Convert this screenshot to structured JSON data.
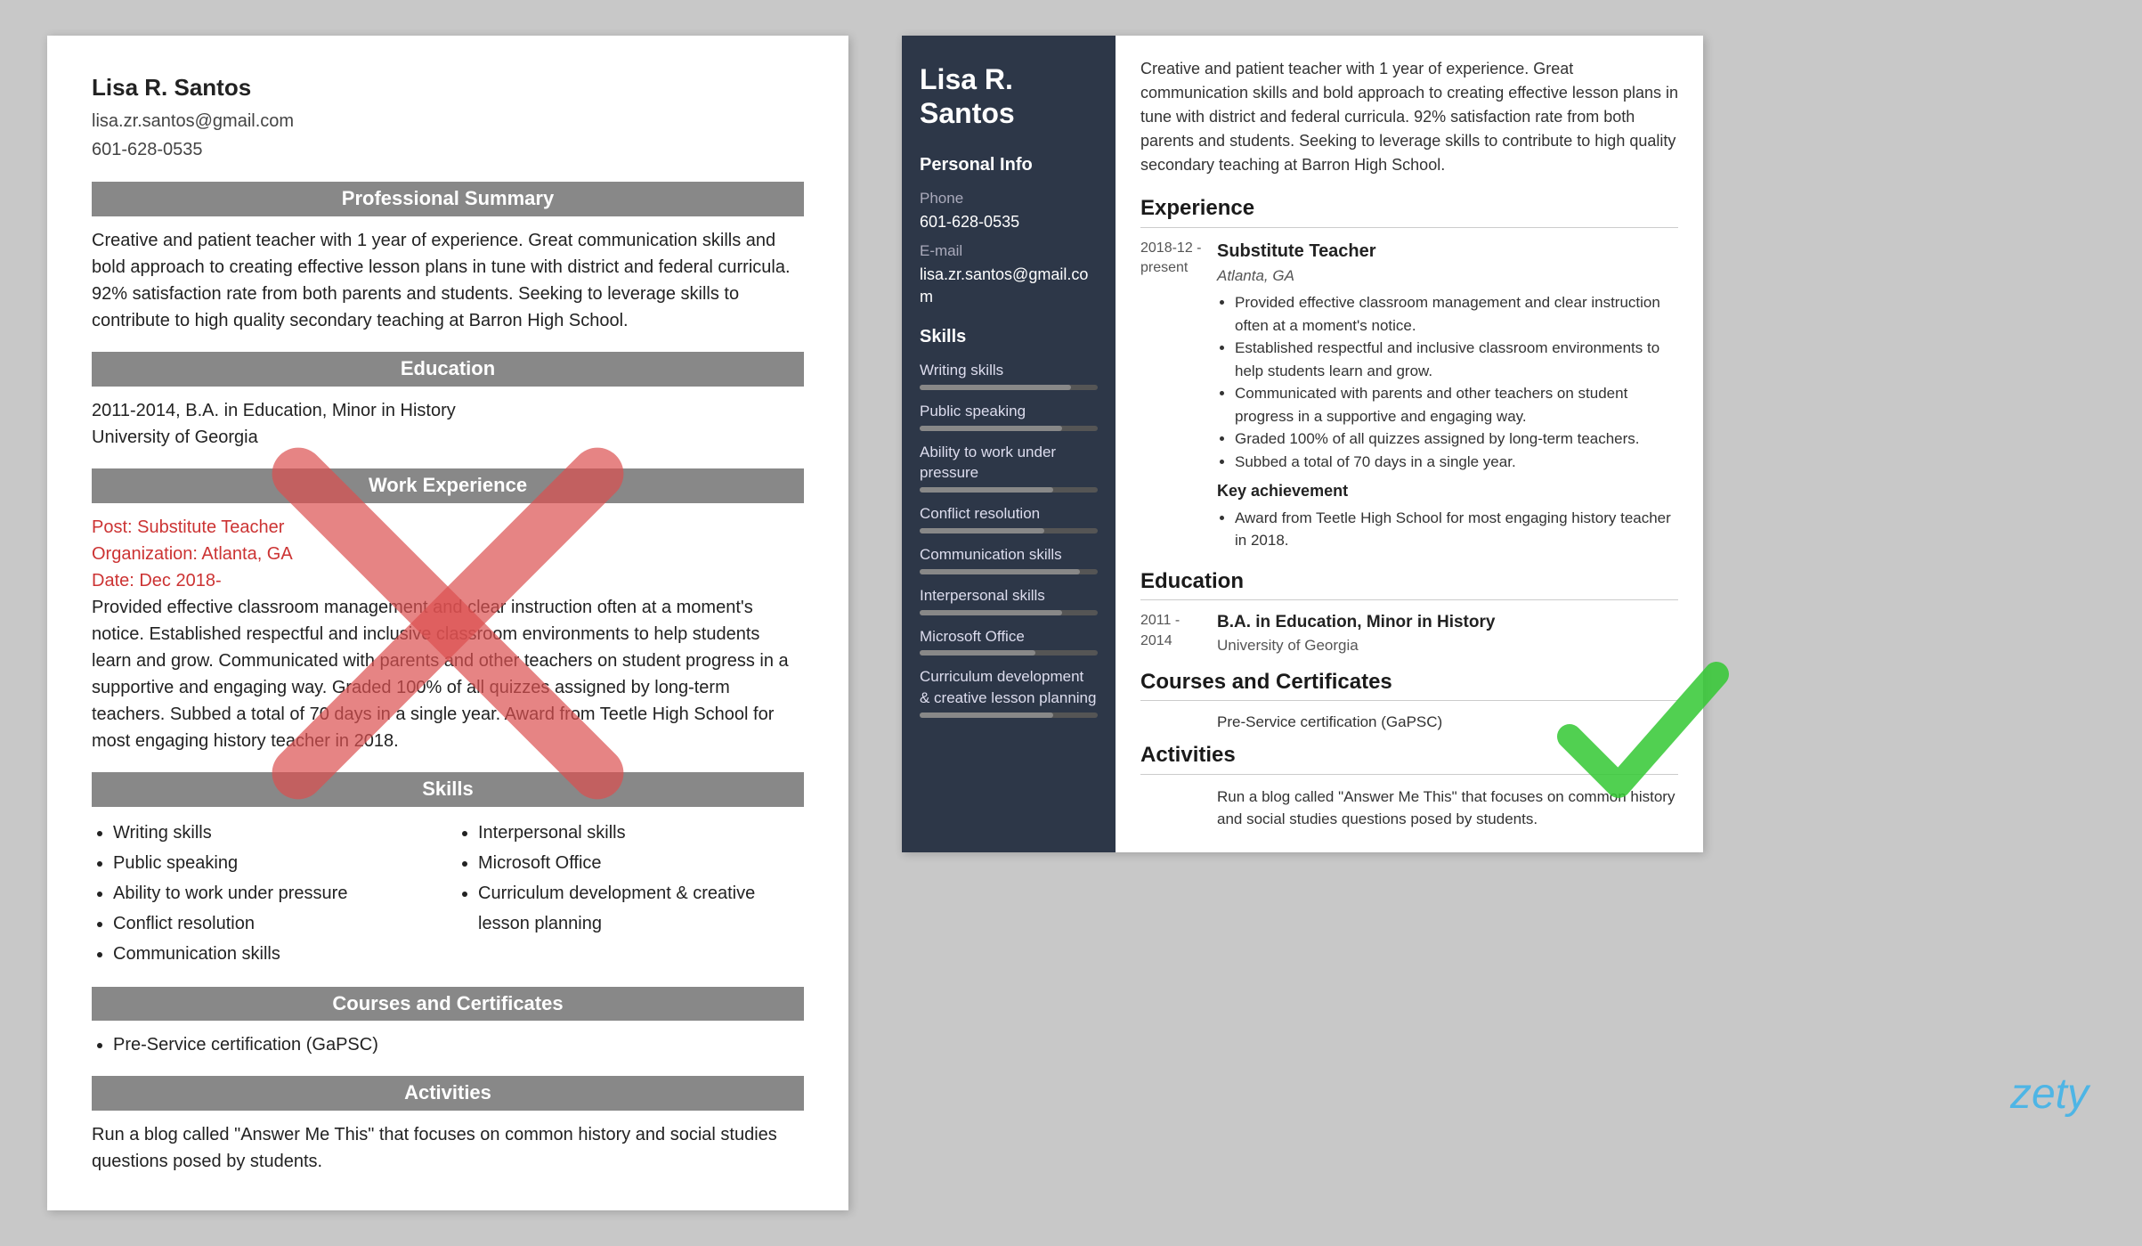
{
  "bad_resume": {
    "name": "Lisa R. Santos",
    "email": "lisa.zr.santos@gmail.com",
    "phone": "601-628-0535",
    "sections": {
      "professional_summary": {
        "title": "Professional Summary",
        "content": "Creative and patient teacher with 1 year of experience. Great communication skills and bold approach to creating effective lesson plans in tune with district and federal curricula. 92% satisfaction rate from both parents and students. Seeking to leverage skills to contribute to high quality secondary teaching at Barron High School."
      },
      "education": {
        "title": "Education",
        "content": "2011-2014, B.A. in Education, Minor in History\nUniversity of Georgia"
      },
      "work_experience": {
        "title": "Work Experience",
        "post_label": "Post:",
        "post_value": "Substitute Teacher",
        "org_label": "Organization:",
        "org_value": "Atlanta, GA",
        "date_label": "Date:",
        "date_value": "Dec 2018-",
        "description": "Provided effective classroom management and clear instruction often at a moment's notice. Established respectful and inclusive classroom environments to help students learn and grow. Communicated with parents and other teachers on student progress in a supportive and engaging way. Graded 100% of all quizzes assigned by long-term teachers. Subbed a total of 70 days in a single year. Award from Teetle High School for most engaging history teacher in 2018."
      },
      "skills": {
        "title": "Skills",
        "col1": [
          "Writing skills",
          "Public speaking",
          "Ability to work under pressure",
          "Conflict resolution",
          "Communication skills"
        ],
        "col2": [
          "Interpersonal skills",
          "Microsoft Office",
          "Curriculum development & creative lesson planning"
        ]
      },
      "courses": {
        "title": "Courses and Certificates",
        "items": [
          "Pre-Service certification (GaPSC)"
        ]
      },
      "activities": {
        "title": "Activities",
        "content": "Run a blog called \"Answer Me This\" that focuses on common history and social studies questions posed by students."
      }
    }
  },
  "good_resume": {
    "sidebar": {
      "name": "Lisa R. Santos",
      "personal_info": {
        "section_title": "Personal Info",
        "phone_label": "Phone",
        "phone_value": "601-628-0535",
        "email_label": "E-mail",
        "email_value": "lisa.zr.santos@gmail.com"
      },
      "skills": {
        "section_title": "Skills",
        "items": [
          {
            "name": "Writing skills",
            "percent": 85
          },
          {
            "name": "Public speaking",
            "percent": 80
          },
          {
            "name": "Ability to work under pressure",
            "percent": 75
          },
          {
            "name": "Conflict resolution",
            "percent": 70
          },
          {
            "name": "Communication skills",
            "percent": 90
          },
          {
            "name": "Interpersonal skills",
            "percent": 80
          },
          {
            "name": "Microsoft Office",
            "percent": 65
          },
          {
            "name": "Curriculum development & creative lesson planning",
            "percent": 75
          }
        ]
      }
    },
    "main": {
      "summary": "Creative and patient teacher with 1 year of experience. Great communication skills and bold approach to creating effective lesson plans in tune with district and federal curricula. 92% satisfaction rate from both parents and students. Seeking to leverage skills to contribute to high quality secondary teaching at Barron High School.",
      "experience": {
        "section_title": "Experience",
        "jobs": [
          {
            "date": "2018-12 - present",
            "title": "Substitute Teacher",
            "location": "Atlanta, GA",
            "bullets": [
              "Provided effective classroom management and clear instruction often at a moment's notice.",
              "Established respectful and inclusive classroom environments to help students learn and grow.",
              "Communicated with parents and other teachers on student progress in a supportive and engaging way.",
              "Graded 100% of all quizzes assigned by long-term teachers.",
              "Subbed a total of 70 days in a single year."
            ],
            "key_achievement_title": "Key achievement",
            "key_achievement": "Award from Teetle High School for most engaging history teacher in 2018."
          }
        ]
      },
      "education": {
        "section_title": "Education",
        "items": [
          {
            "date": "2011 - 2014",
            "degree": "B.A. in Education, Minor in History",
            "school": "University of Georgia"
          }
        ]
      },
      "courses": {
        "section_title": "Courses and Certificates",
        "items": [
          "Pre-Service certification (GaPSC)"
        ]
      },
      "activities": {
        "section_title": "Activities",
        "content": "Run a blog called \"Answer Me This\" that focuses on common history and social studies questions posed by students."
      }
    }
  },
  "zety_label": "zety"
}
